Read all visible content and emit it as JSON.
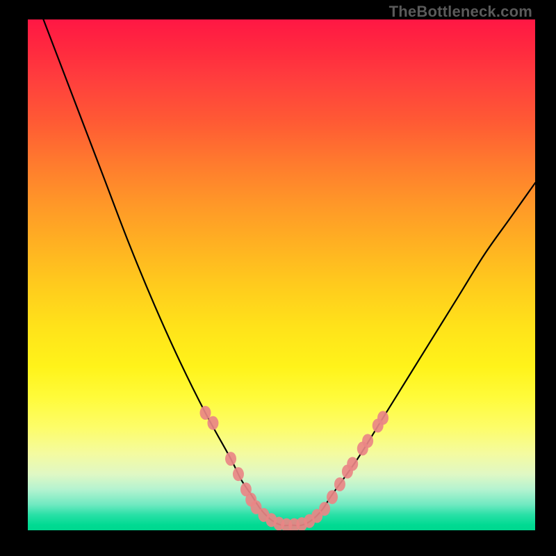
{
  "attribution": "TheBottleneck.com",
  "chart_data": {
    "type": "line",
    "title": "",
    "xlabel": "",
    "ylabel": "",
    "xlim": [
      0,
      100
    ],
    "ylim": [
      0,
      100
    ],
    "series": [
      {
        "name": "bottleneck-curve",
        "x": [
          0,
          5,
          10,
          15,
          20,
          25,
          30,
          35,
          40,
          42,
          44,
          46,
          48,
          50,
          52,
          54,
          56,
          58,
          60,
          65,
          70,
          75,
          80,
          85,
          90,
          95,
          100
        ],
        "y": [
          108,
          95,
          82,
          69,
          56,
          44,
          33,
          23,
          14,
          10,
          7,
          4,
          2,
          1,
          1,
          1,
          2,
          4,
          7,
          14,
          22,
          30,
          38,
          46,
          54,
          61,
          68
        ]
      }
    ],
    "markers": {
      "name": "data-dots",
      "points": [
        {
          "x": 35.0,
          "y": 23.0
        },
        {
          "x": 36.5,
          "y": 21.0
        },
        {
          "x": 40.0,
          "y": 14.0
        },
        {
          "x": 41.5,
          "y": 11.0
        },
        {
          "x": 43.0,
          "y": 8.0
        },
        {
          "x": 44.0,
          "y": 6.0
        },
        {
          "x": 45.0,
          "y": 4.5
        },
        {
          "x": 46.5,
          "y": 3.0
        },
        {
          "x": 48.0,
          "y": 2.0
        },
        {
          "x": 49.5,
          "y": 1.3
        },
        {
          "x": 51.0,
          "y": 1.0
        },
        {
          "x": 52.5,
          "y": 1.0
        },
        {
          "x": 54.0,
          "y": 1.2
        },
        {
          "x": 55.5,
          "y": 1.8
        },
        {
          "x": 57.0,
          "y": 2.8
        },
        {
          "x": 58.5,
          "y": 4.2
        },
        {
          "x": 60.0,
          "y": 6.5
        },
        {
          "x": 61.5,
          "y": 9.0
        },
        {
          "x": 63.0,
          "y": 11.5
        },
        {
          "x": 64.0,
          "y": 13.0
        },
        {
          "x": 66.0,
          "y": 16.0
        },
        {
          "x": 67.0,
          "y": 17.5
        },
        {
          "x": 69.0,
          "y": 20.5
        },
        {
          "x": 70.0,
          "y": 22.0
        }
      ]
    },
    "background_gradient": {
      "top": "#ff1744",
      "mid": "#fff31a",
      "bottom": "#00d88f"
    }
  }
}
